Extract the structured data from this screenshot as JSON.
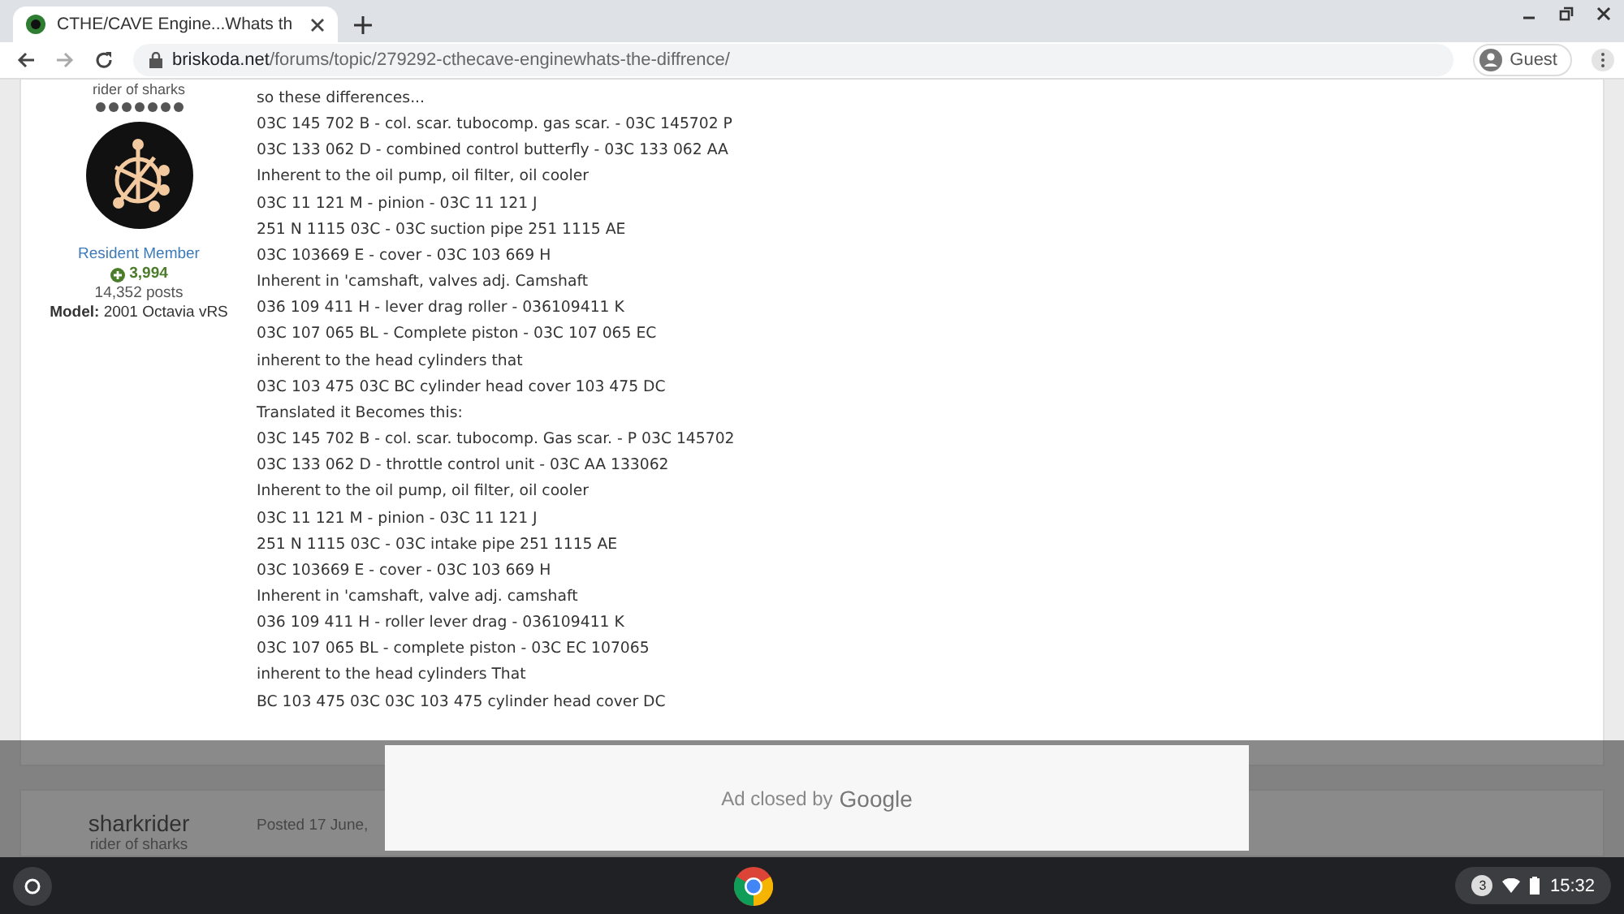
{
  "browser": {
    "tab": {
      "title": "CTHE/CAVE Engine...Whats th",
      "selected": true
    },
    "url": {
      "domain": "briskoda.net",
      "path": "/forums/topic/279292-cthecave-enginewhats-the-diffrence/"
    },
    "profile": "Guest"
  },
  "post": {
    "author": {
      "title": "rider of sharks",
      "group": "Resident Member",
      "reputation": "3,994",
      "posts": "14,352 posts",
      "model_label": "Model:",
      "model": "2001 Octavia vRS"
    },
    "lines": [
      "so these differences...",
      "03C 145 702 B - col. scar. tubocomp. gas scar. - 03C 145702 P",
      "03C 133 062 D - combined control butterfly - 03C 133 062 AA",
      "Inherent to the oil pump, oil filter, oil cooler",
      "03C 11 121 M - pinion - 03C 11 121 J",
      "251 N 1115 03C - 03C suction pipe 251 1115 AE",
      "03C 103669 E - cover - 03C 103 669 H",
      "Inherent in 'camshaft, valves adj. Camshaft",
      "036 109 411 H - lever drag roller - 036109411 K",
      "03C 107 065 BL - Complete piston - 03C 107 065 EC",
      "inherent to the head cylinders that",
      "03C 103 475 03C BC cylinder head cover 103 475 DC",
      "Translated it Becomes this:",
      "03C 145 702 B - col. scar. tubocomp. Gas scar. - P 03C 145702",
      "03C 133 062 D - throttle control unit - 03C AA 133062",
      "Inherent to the oil pump, oil filter, oil cooler",
      "03C 11 121 M - pinion - 03C 11 121 J",
      "251 N 1115 03C - 03C intake pipe 251 1115 AE",
      "03C 103669 E - cover - 03C 103 669 H",
      "Inherent in 'camshaft, valve adj. camshaft",
      "036 109 411 H - roller lever drag - 036109411 K",
      "03C 107 065 BL - complete piston - 03C EC 107065",
      "inherent to the head cylinders That",
      "BC 103 475 03C 03C 103 475 cylinder head cover DC"
    ]
  },
  "next_post": {
    "author": "sharkrider",
    "title": "rider of sharks",
    "posted": "Posted 17 June,"
  },
  "ad": {
    "text": "Ad closed by",
    "brand": "Google"
  },
  "taskbar": {
    "notifications": "3",
    "time": "15:32"
  }
}
